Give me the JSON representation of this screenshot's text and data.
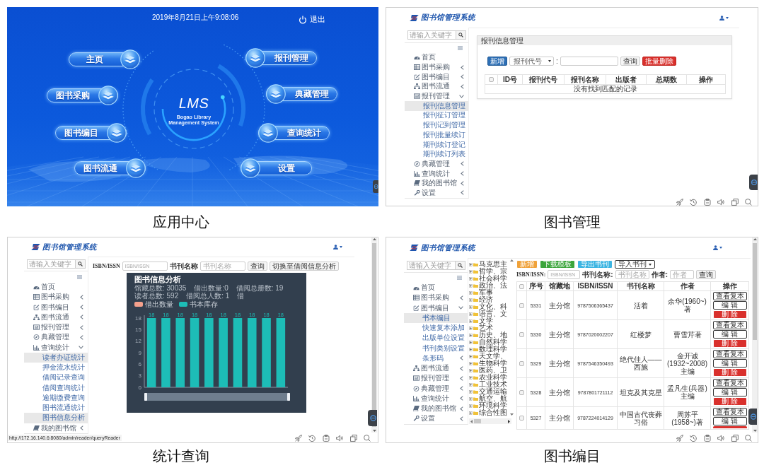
{
  "panels": [
    {
      "kind": "app_center",
      "caption": "应用中心",
      "datetime": "2019年8月21日上午9:08:06",
      "logout": "退出",
      "logo_title": "LMS",
      "logo_subtitle": [
        "Bogao Library",
        "Management System"
      ],
      "modules_left": [
        "主页",
        "图书采购",
        "图书编目",
        "图书流通"
      ],
      "modules_right": [
        "报刊管理",
        "典藏管理",
        "查询统计",
        "设置"
      ]
    },
    {
      "kind": "periodicals",
      "caption": "图书管理",
      "brand": "图书馆管理系统",
      "search_placeholder": "请输入关键字",
      "sidebar": [
        {
          "label": "首页",
          "submenu": false,
          "expanded": false,
          "selected": false
        },
        {
          "label": "图书采购",
          "submenu": true,
          "expanded": false,
          "selected": false
        },
        {
          "label": "图书编目",
          "submenu": true,
          "expanded": false,
          "selected": false
        },
        {
          "label": "图书流通",
          "submenu": true,
          "expanded": false,
          "selected": false
        },
        {
          "label": "报刊管理",
          "submenu": true,
          "expanded": true,
          "selected": false,
          "children": [
            {
              "label": "报刊信息管理",
              "selected": true
            },
            {
              "label": "报刊征订管理",
              "selected": false
            },
            {
              "label": "报刊记到管理",
              "selected": false
            },
            {
              "label": "报刊批量续订",
              "selected": false
            },
            {
              "label": "期刊续订登记",
              "selected": false
            },
            {
              "label": "期刊续订列表",
              "selected": false
            }
          ]
        },
        {
          "label": "典藏管理",
          "submenu": true,
          "expanded": false,
          "selected": false
        },
        {
          "label": "查询统计",
          "submenu": true,
          "expanded": false,
          "selected": false
        },
        {
          "label": "我的图书馆",
          "submenu": true,
          "expanded": false,
          "selected": false
        },
        {
          "label": "设置",
          "submenu": true,
          "expanded": false,
          "selected": false
        }
      ],
      "content": {
        "title": "报刊信息管理",
        "add_button": "新增",
        "filter_select": "报刊代号",
        "separator": ":",
        "query_button": "查询",
        "batch_delete_button": "批量删除",
        "table": {
          "all_checked": false,
          "columns": [
            "ID号",
            "报刊代号",
            "报刊名称",
            "出版者",
            "总期数",
            "操作"
          ],
          "empty_text": "没有找到匹配的记录"
        }
      }
    },
    {
      "kind": "statistics",
      "caption": "统计查询",
      "brand": "图书馆管理系统",
      "search_placeholder": "请输入关键字",
      "vertical_scrollbar": true,
      "sidebar": [
        {
          "label": "首页",
          "submenu": false,
          "expanded": false,
          "selected": false
        },
        {
          "label": "图书采购",
          "submenu": true,
          "expanded": false,
          "selected": false
        },
        {
          "label": "图书编目",
          "submenu": true,
          "expanded": false,
          "selected": false
        },
        {
          "label": "图书流通",
          "submenu": true,
          "expanded": false,
          "selected": false
        },
        {
          "label": "报刊管理",
          "submenu": true,
          "expanded": false,
          "selected": false
        },
        {
          "label": "典藏管理",
          "submenu": true,
          "expanded": false,
          "selected": false
        },
        {
          "label": "查询统计",
          "submenu": true,
          "expanded": true,
          "selected": false,
          "children": [
            {
              "label": "读者办证统计",
              "selected": true
            },
            {
              "label": "押金流水统计",
              "selected": false
            },
            {
              "label": "借阅记录查询",
              "selected": false
            },
            {
              "label": "借阅查询统计",
              "selected": false
            },
            {
              "label": "逾期缴费查询",
              "selected": false
            },
            {
              "label": "图书流通统计",
              "selected": false
            },
            {
              "label": "图书信息分析",
              "selected": true
            }
          ]
        },
        {
          "label": "我的图书馆",
          "submenu": true,
          "expanded": false,
          "selected": false
        }
      ],
      "filters": {
        "isbn_label": "ISBN/ISSN",
        "isbn_placeholder": "ISBN/ISSN",
        "title_label": "书刊名称",
        "title_placeholder": "书刊名称",
        "query_button": "查询",
        "switch_button": "切换至借阅信息分析"
      },
      "chart": {
        "stats": [
          "馆藏总数: 30035",
          "借出数量:0",
          "借阅总册数: 19",
          "读者总数: 592",
          "借阅总人数: 1",
          "借"
        ],
        "chart_data": {
          "type": "bar",
          "title": "图书信息分析",
          "series": [
            {
              "name": "借出数量",
              "color": "#f4a08c",
              "values": [
                null,
                null,
                null,
                null,
                null,
                null,
                null,
                null,
                null,
                null
              ]
            },
            {
              "name": "书本库存",
              "color": "#1dbdb7",
              "values": [
                18,
                18,
                18,
                18,
                18,
                18,
                18,
                18,
                18,
                18
              ]
            }
          ],
          "ylim": [
            0,
            18
          ],
          "yticks": [
            0,
            3,
            6,
            9,
            12,
            15,
            18
          ],
          "data_labels": true
        },
        "range_slider": {
          "level": 1
        }
      },
      "status_url": "http://172.16.140.6:8080/admin/reader/queryReader"
    },
    {
      "kind": "cataloging",
      "caption": "图书编目",
      "brand": "图书馆管理系统",
      "search_placeholder": "请输入关键字",
      "vertical_scrollbar": true,
      "sidebar": [
        {
          "label": "首页",
          "submenu": false,
          "expanded": false,
          "selected": false
        },
        {
          "label": "图书采购",
          "submenu": true,
          "expanded": false,
          "selected": false
        },
        {
          "label": "图书编目",
          "submenu": true,
          "expanded": true,
          "selected": false,
          "children": [
            {
              "label": "书本编目",
              "selected": true,
              "submenu": false
            },
            {
              "label": "快速复本添加",
              "selected": false,
              "submenu": false
            },
            {
              "label": "出版单位设置",
              "selected": false,
              "submenu": false
            },
            {
              "label": "书刊类别设置",
              "selected": false,
              "submenu": false
            },
            {
              "label": "条形码",
              "selected": false,
              "submenu": true
            }
          ]
        },
        {
          "label": "图书流通",
          "submenu": true,
          "expanded": false,
          "selected": false
        },
        {
          "label": "报刊管理",
          "submenu": true,
          "expanded": false,
          "selected": false
        },
        {
          "label": "典藏管理",
          "submenu": true,
          "expanded": false,
          "selected": false
        },
        {
          "label": "查询统计",
          "submenu": true,
          "expanded": false,
          "selected": false
        },
        {
          "label": "我的图书馆",
          "submenu": true,
          "expanded": false,
          "selected": false
        },
        {
          "label": "设置",
          "submenu": true,
          "expanded": false,
          "selected": false
        }
      ],
      "category_tree": [
        {
          "label": "马克思主",
          "expanded": false
        },
        {
          "label": "哲学、宗",
          "expanded": false
        },
        {
          "label": "社会科学",
          "expanded": false
        },
        {
          "label": "政治、法",
          "expanded": false
        },
        {
          "label": "军事",
          "expanded": false
        },
        {
          "label": "经济",
          "expanded": false
        },
        {
          "label": "文化、科",
          "expanded": false
        },
        {
          "label": "语言、文",
          "expanded": false
        },
        {
          "label": "文学",
          "expanded": false
        },
        {
          "label": "艺术",
          "expanded": false
        },
        {
          "label": "历史、地",
          "expanded": false
        },
        {
          "label": "自然科学",
          "expanded": false
        },
        {
          "label": "数理科学",
          "expanded": false
        },
        {
          "label": "天文学、",
          "expanded": false
        },
        {
          "label": "生物科学",
          "expanded": false
        },
        {
          "label": "医药、卫",
          "expanded": false
        },
        {
          "label": "农业科学",
          "expanded": false
        },
        {
          "label": "工业技术",
          "expanded": false
        },
        {
          "label": "交通运输",
          "expanded": false
        },
        {
          "label": "航空、航",
          "expanded": false
        },
        {
          "label": "环境科学",
          "expanded": false
        },
        {
          "label": "综合性图",
          "expanded": false
        }
      ],
      "toolbar": [
        {
          "label": "新增",
          "kind": "warning"
        },
        {
          "label": "下载模板",
          "kind": "success"
        },
        {
          "label": "导出书刊",
          "kind": "info"
        },
        {
          "label": "导入书刊",
          "kind": "dropdown"
        }
      ],
      "filters": {
        "isbn_label": "ISBN/ISSN:",
        "isbn_placeholder": "ISBN/ISSN",
        "title_label": "书刊名称:",
        "title_placeholder": "书刊名称",
        "author_label": "作者:",
        "author_placeholder": "作者",
        "query_button": "查询"
      },
      "table": {
        "all_checked": false,
        "columns": [
          "序号",
          "馆藏地",
          "ISBN/ISSN",
          "书刊名称",
          "作者",
          "操作"
        ],
        "rows": [
          {
            "checked": false,
            "cells": [
              "5331",
              "主分馆",
              "9787506365437",
              "活着",
              "余华(1960~)著"
            ],
            "actions": [
              {
                "label": "查看复本",
                "kind": "default"
              },
              {
                "label": "编 辑",
                "kind": "default"
              },
              {
                "label": "删 除",
                "kind": "danger"
              }
            ]
          },
          {
            "checked": false,
            "cells": [
              "5330",
              "主分馆",
              "9787020002207",
              "红楼梦",
              "曹雪芹著"
            ],
            "actions": [
              {
                "label": "查看复本",
                "kind": "default"
              },
              {
                "label": "编 辑",
                "kind": "default"
              },
              {
                "label": "删 除",
                "kind": "danger"
              }
            ]
          },
          {
            "checked": false,
            "cells": [
              "5329",
              "主分馆",
              "9787546350493",
              "绝代佳人——西施",
              "金开诚(1932~2008)主编"
            ],
            "actions": [
              {
                "label": "查看复本",
                "kind": "default"
              },
              {
                "label": "编 辑",
                "kind": "default"
              },
              {
                "label": "删 除",
                "kind": "danger"
              }
            ]
          },
          {
            "checked": false,
            "cells": [
              "5328",
              "主分馆",
              "9787801721112",
              "坦克及其克星",
              "孟凡生(兵器)主编"
            ],
            "actions": [
              {
                "label": "查看复本",
                "kind": "default"
              },
              {
                "label": "编 辑",
                "kind": "default"
              },
              {
                "label": "删 除",
                "kind": "danger"
              }
            ]
          },
          {
            "checked": false,
            "cells": [
              "5327",
              "主分馆",
              "9787224014129",
              "中国古代丧葬习俗",
              "周苏平(1958~)著"
            ],
            "actions": [
              {
                "label": "查看复本",
                "kind": "default"
              },
              {
                "label": "编 辑",
                "kind": "default"
              },
              {
                "kind": "danger"
              }
            ]
          }
        ]
      }
    }
  ]
}
